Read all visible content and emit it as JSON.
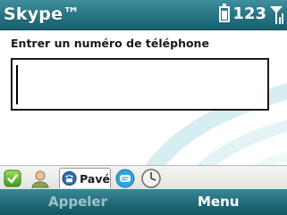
{
  "app": {
    "title": "Skype™"
  },
  "status": {
    "network_count": "123"
  },
  "dialer": {
    "prompt": "Entrer un numéro de téléphone",
    "input_value": ""
  },
  "tabs": [
    {
      "icon": "check-status-icon",
      "label": ""
    },
    {
      "icon": "contact-person-icon",
      "label": ""
    },
    {
      "icon": "phone-keypad-icon",
      "label": "Pavé",
      "active": true
    },
    {
      "icon": "chat-bubble-icon",
      "label": ""
    },
    {
      "icon": "history-clock-icon",
      "label": ""
    }
  ],
  "softkeys": {
    "left": "Appeler",
    "right": "Menu"
  },
  "colors": {
    "accent": "#2c7a88",
    "softkey_disabled": "#9fc3c9"
  }
}
